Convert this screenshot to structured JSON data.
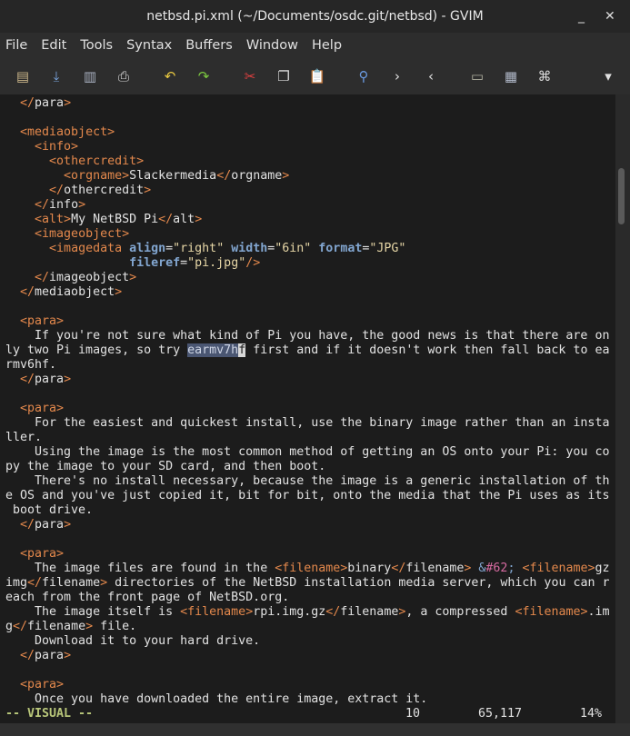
{
  "window": {
    "title": "netbsd.pi.xml (~/Documents/osdc.git/netbsd) - GVIM",
    "minimize": "_",
    "close": "✕"
  },
  "menu": [
    "File",
    "Edit",
    "Tools",
    "Syntax",
    "Buffers",
    "Window",
    "Help"
  ],
  "toolbar": [
    {
      "name": "open-icon",
      "glyph": "▤",
      "color": "#c8b488"
    },
    {
      "name": "save-download-icon",
      "glyph": "⤓",
      "color": "#7aa6e0"
    },
    {
      "name": "save-all-icon",
      "glyph": "▥",
      "color": "#a8b0c0"
    },
    {
      "name": "print-icon",
      "glyph": "⎙",
      "color": "#d8d8d8"
    },
    {
      "name": "undo-icon",
      "glyph": "↶",
      "color": "#e8c840"
    },
    {
      "name": "redo-icon",
      "glyph": "↷",
      "color": "#7cc840"
    },
    {
      "name": "cut-icon",
      "glyph": "✂",
      "color": "#e04040"
    },
    {
      "name": "copy-icon",
      "glyph": "❐",
      "color": "#d8d8d8"
    },
    {
      "name": "paste-icon",
      "glyph": "📋",
      "color": "#d8b060"
    },
    {
      "name": "find-replace-icon",
      "glyph": "⚲",
      "color": "#6a9ae0"
    },
    {
      "name": "find-next-icon",
      "glyph": "›",
      "color": "#e0e0e0"
    },
    {
      "name": "find-prev-icon",
      "glyph": "‹",
      "color": "#e0e0e0"
    },
    {
      "name": "load-session-icon",
      "glyph": "▭",
      "color": "#b0b0a0"
    },
    {
      "name": "save-session-icon",
      "glyph": "▦",
      "color": "#b0b8c8"
    },
    {
      "name": "run-script-icon",
      "glyph": "⌘",
      "color": "#d8d8d8"
    },
    {
      "name": "overflow-chevron-icon",
      "glyph": "▾",
      "color": "#e0e0e0"
    }
  ],
  "lines": [
    [
      [
        "w",
        "  "
      ],
      [
        "o",
        "</"
      ],
      [
        "w",
        "para"
      ],
      [
        "o",
        ">"
      ]
    ],
    [],
    [
      [
        "w",
        "  "
      ],
      [
        "o",
        "<mediaobject>"
      ]
    ],
    [
      [
        "w",
        "    "
      ],
      [
        "o",
        "<info>"
      ]
    ],
    [
      [
        "w",
        "      "
      ],
      [
        "o",
        "<othercredit>"
      ]
    ],
    [
      [
        "w",
        "        "
      ],
      [
        "o",
        "<orgname>"
      ],
      [
        "w",
        "Slackermedia"
      ],
      [
        "o",
        "</"
      ],
      [
        "w",
        "orgname"
      ],
      [
        "o",
        ">"
      ]
    ],
    [
      [
        "w",
        "      "
      ],
      [
        "o",
        "</"
      ],
      [
        "w",
        "othercredit"
      ],
      [
        "o",
        ">"
      ]
    ],
    [
      [
        "w",
        "    "
      ],
      [
        "o",
        "</"
      ],
      [
        "w",
        "info"
      ],
      [
        "o",
        ">"
      ]
    ],
    [
      [
        "w",
        "    "
      ],
      [
        "o",
        "<alt>"
      ],
      [
        "w",
        "My NetBSD Pi"
      ],
      [
        "o",
        "</"
      ],
      [
        "w",
        "alt"
      ],
      [
        "o",
        ">"
      ]
    ],
    [
      [
        "w",
        "    "
      ],
      [
        "o",
        "<imageobject>"
      ]
    ],
    [
      [
        "w",
        "      "
      ],
      [
        "o",
        "<imagedata "
      ],
      [
        "a",
        "align"
      ],
      [
        "w",
        "="
      ],
      [
        "v",
        "\"right\" "
      ],
      [
        "a",
        "width"
      ],
      [
        "w",
        "="
      ],
      [
        "v",
        "\"6in\" "
      ],
      [
        "a",
        "format"
      ],
      [
        "w",
        "="
      ],
      [
        "v",
        "\"JPG\""
      ]
    ],
    [
      [
        "w",
        "                 "
      ],
      [
        "a",
        "fileref"
      ],
      [
        "w",
        "="
      ],
      [
        "v",
        "\"pi.jpg\""
      ],
      [
        "o",
        "/>"
      ]
    ],
    [
      [
        "w",
        "    "
      ],
      [
        "o",
        "</"
      ],
      [
        "w",
        "imageobject"
      ],
      [
        "o",
        ">"
      ]
    ],
    [
      [
        "w",
        "  "
      ],
      [
        "o",
        "</"
      ],
      [
        "w",
        "mediaobject"
      ],
      [
        "o",
        ">"
      ]
    ],
    [],
    [
      [
        "w",
        "  "
      ],
      [
        "o",
        "<para>"
      ]
    ],
    [
      [
        "w",
        "    If you're not sure what kind of Pi you have, the good news is that there are on"
      ]
    ],
    [
      [
        "w",
        "ly two Pi images, so try "
      ],
      [
        "sel",
        "earmv7h"
      ],
      [
        "cur",
        "f"
      ],
      [
        "w",
        " first and if it doesn't work then fall back to ea"
      ]
    ],
    [
      [
        "w",
        "rmv6hf."
      ]
    ],
    [
      [
        "w",
        "  "
      ],
      [
        "o",
        "</"
      ],
      [
        "w",
        "para"
      ],
      [
        "o",
        ">"
      ]
    ],
    [],
    [
      [
        "w",
        "  "
      ],
      [
        "o",
        "<para>"
      ]
    ],
    [
      [
        "w",
        "    For the easiest and quickest install, use the binary image rather than an insta"
      ]
    ],
    [
      [
        "w",
        "ller."
      ]
    ],
    [
      [
        "w",
        "    Using the image is the most common method of getting an OS onto your Pi: you co"
      ]
    ],
    [
      [
        "w",
        "py the image to your SD card, and then boot."
      ]
    ],
    [
      [
        "w",
        "    There's no install necessary, because the image is a generic installation of th"
      ]
    ],
    [
      [
        "w",
        "e OS and you've just copied it, bit for bit, onto the media that the Pi uses as its"
      ]
    ],
    [
      [
        "w",
        " boot drive."
      ]
    ],
    [
      [
        "w",
        "  "
      ],
      [
        "o",
        "</"
      ],
      [
        "w",
        "para"
      ],
      [
        "o",
        ">"
      ]
    ],
    [],
    [
      [
        "w",
        "  "
      ],
      [
        "o",
        "<para>"
      ]
    ],
    [
      [
        "w",
        "    The image files are found in the "
      ],
      [
        "o",
        "<filename>"
      ],
      [
        "w",
        "binary"
      ],
      [
        "o",
        "</"
      ],
      [
        "w",
        "filename"
      ],
      [
        "o",
        "> "
      ],
      [
        "eb",
        "&"
      ],
      [
        "ep",
        "#62"
      ],
      [
        "eb",
        ";"
      ],
      [
        "w",
        " "
      ],
      [
        "o",
        "<filename>"
      ],
      [
        "w",
        "gz"
      ]
    ],
    [
      [
        "w",
        "img"
      ],
      [
        "o",
        "</"
      ],
      [
        "w",
        "filename"
      ],
      [
        "o",
        ">"
      ],
      [
        "w",
        " directories of the NetBSD installation media server, which you can r"
      ]
    ],
    [
      [
        "w",
        "each from the front page of NetBSD.org."
      ]
    ],
    [
      [
        "w",
        "    The image itself is "
      ],
      [
        "o",
        "<filename>"
      ],
      [
        "w",
        "rpi.img.gz"
      ],
      [
        "o",
        "</"
      ],
      [
        "w",
        "filename"
      ],
      [
        "o",
        ">"
      ],
      [
        "w",
        ", a compressed "
      ],
      [
        "o",
        "<filename>"
      ],
      [
        "w",
        ".im"
      ]
    ],
    [
      [
        "w",
        "g"
      ],
      [
        "o",
        "</"
      ],
      [
        "w",
        "filename"
      ],
      [
        "o",
        ">"
      ],
      [
        "w",
        " file."
      ]
    ],
    [
      [
        "w",
        "    Download it to your hard drive."
      ]
    ],
    [
      [
        "w",
        "  "
      ],
      [
        "o",
        "</"
      ],
      [
        "w",
        "para"
      ],
      [
        "o",
        ">"
      ]
    ],
    [],
    [
      [
        "w",
        "  "
      ],
      [
        "o",
        "<para>"
      ]
    ],
    [
      [
        "w",
        "    Once you have downloaded the entire image, extract it."
      ]
    ]
  ],
  "status": {
    "mode": "-- VISUAL --",
    "selected": "10",
    "position": "65,117",
    "percent": "14%"
  },
  "scroll_position_percent": 14
}
